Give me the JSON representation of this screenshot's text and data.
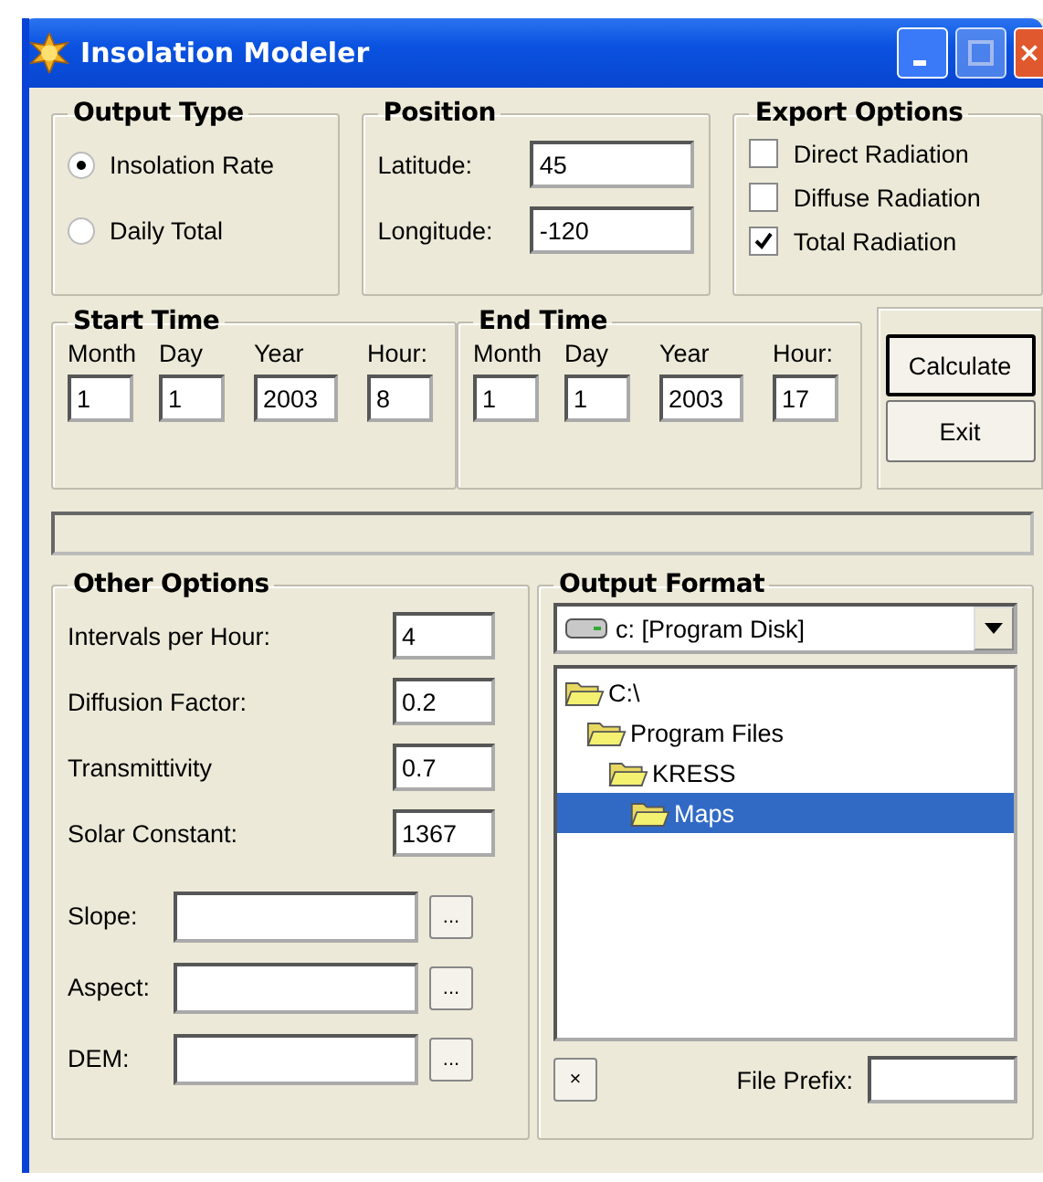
{
  "window": {
    "title": "Insolation Modeler"
  },
  "output_type": {
    "title": "Output Type",
    "options": [
      {
        "label": "Insolation Rate",
        "selected": true
      },
      {
        "label": "Daily Total",
        "selected": false
      }
    ]
  },
  "position": {
    "title": "Position",
    "fields": [
      {
        "label": "Latitude:",
        "value": "45"
      },
      {
        "label": "Longitude:",
        "value": "-120"
      }
    ]
  },
  "export_options": {
    "title": "Export Options",
    "options": [
      {
        "label": "Direct Radiation",
        "checked": false
      },
      {
        "label": "Diffuse Radiation",
        "checked": false
      },
      {
        "label": "Total Radiation",
        "checked": true
      }
    ]
  },
  "start_time": {
    "title": "Start Time",
    "fields": [
      {
        "label": "Month",
        "value": "1"
      },
      {
        "label": "Day",
        "value": "1"
      },
      {
        "label": "Year",
        "value": "2003"
      },
      {
        "label": "Hour:",
        "value": "8"
      }
    ]
  },
  "end_time": {
    "title": "End Time",
    "fields": [
      {
        "label": "Month",
        "value": "1"
      },
      {
        "label": "Day",
        "value": "1"
      },
      {
        "label": "Year",
        "value": "2003"
      },
      {
        "label": "Hour:",
        "value": "17"
      }
    ]
  },
  "buttons": [
    {
      "label": "Calculate",
      "default": true
    },
    {
      "label": "Exit",
      "default": false
    }
  ],
  "other_options": {
    "title": "Other Options",
    "fields": [
      {
        "label": "Intervals per Hour:",
        "value": "4"
      },
      {
        "label": "Diffusion Factor:",
        "value": "0.2"
      },
      {
        "label": "Transmittivity",
        "value": "0.7"
      },
      {
        "label": "Solar Constant:",
        "value": "1367"
      }
    ],
    "file_fields": [
      {
        "label": "Slope:",
        "button": "..."
      },
      {
        "label": "Aspect:",
        "button": "..."
      },
      {
        "label": "DEM:",
        "button": "..."
      }
    ]
  },
  "output_format": {
    "title": "Output Format",
    "drive": "c: [Program Disk]",
    "tree": [
      {
        "label": "C:\\",
        "selected": false,
        "children": [
          {
            "label": "Program Files",
            "selected": false,
            "children": [
              {
                "label": "KRESS",
                "selected": false,
                "children": [
                  {
                    "label": "Maps",
                    "selected": true
                  }
                ]
              }
            ]
          }
        ]
      }
    ],
    "clear_button": "×",
    "prefix_label": "File Prefix:"
  }
}
